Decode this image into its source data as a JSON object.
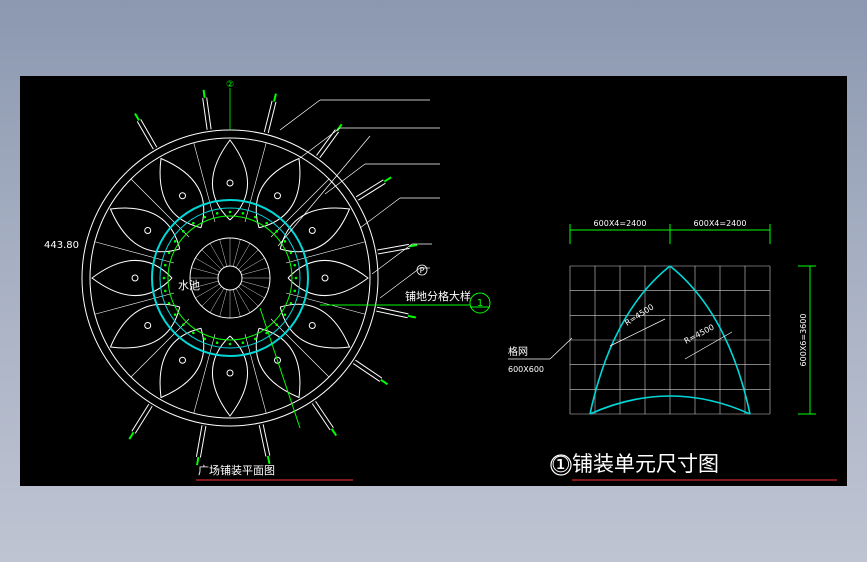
{
  "plan": {
    "title": "广场铺装平面图",
    "center_label": "水池",
    "dimension_left": "443.80",
    "detail_callout_text": "铺地分格大样",
    "detail_callout_number": "1",
    "top_marker": "②",
    "side_marker": "P"
  },
  "detail": {
    "title": "铺装单元尺寸图",
    "title_number": "①",
    "dim_top_left": "600X4=2400",
    "dim_top_right": "600X4=2400",
    "dim_right": "600X6=3600",
    "grid_label": "格网",
    "grid_size": "600X600",
    "radius_left": "R=4500",
    "radius_right": "R=4500",
    "grid_cols": 8,
    "grid_rows": 6
  },
  "colors": {
    "white": "#ffffff",
    "green": "#00ff00",
    "cyan": "#00d8d8",
    "red": "#ff3030",
    "yellow": "#ffff00"
  }
}
